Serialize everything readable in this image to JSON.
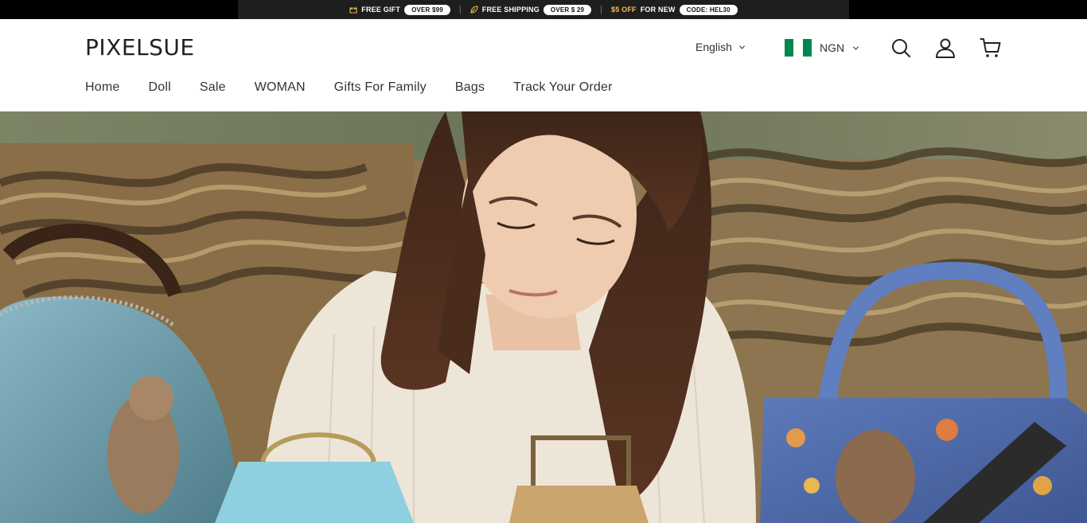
{
  "announcement": {
    "gift_label": "FREE GIFT",
    "gift_pill": "OVER $99",
    "separator_1": "|",
    "shipping_label": "FREE SHIPPING",
    "shipping_pill": "OVER $ 29",
    "separator_2": "|",
    "discount_amount": "$5 OFF",
    "discount_label": "FOR NEW",
    "discount_pill": "CODE: HEL30"
  },
  "header": {
    "logo": "PIXELSUE",
    "language": "English",
    "currency": "NGN",
    "flag_colors": [
      "#008751",
      "#ffffff",
      "#008751"
    ]
  },
  "nav": {
    "items": [
      "Home",
      "Doll",
      "Sale",
      "WOMAN",
      "Gifts For Family",
      "Bags",
      "Track Your Order"
    ]
  },
  "icons": {
    "gift": "gift-icon",
    "shipping": "leaf-icon",
    "search": "search-icon",
    "account": "user-icon",
    "cart": "cart-icon",
    "chevron": "chevron-down-icon"
  },
  "colors": {
    "announcement_bg": "#1e1e1e",
    "discount_accent": "#f3c44a"
  }
}
